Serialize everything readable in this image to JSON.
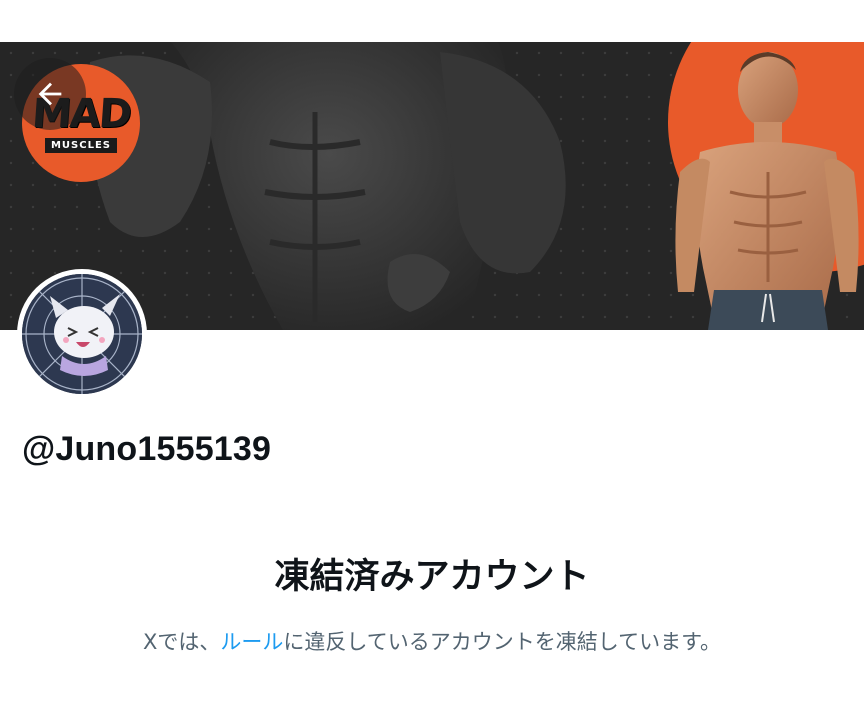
{
  "header": {
    "back_icon": "arrow-left-icon",
    "banner": {
      "logo_top": "MAD",
      "logo_bottom": "MUSCLES",
      "accent_color": "#e85a2a",
      "background_color": "#262626"
    }
  },
  "profile": {
    "handle": "@Juno1555139",
    "avatar_icon": "avatar-anime-character"
  },
  "notice": {
    "title": "凍結済みアカウント",
    "body_prefix": "Xでは、",
    "rules_link": "ルール",
    "body_suffix": "に違反しているアカウントを凍結しています。",
    "link_color": "#1d9bf0",
    "text_color": "#536471"
  }
}
